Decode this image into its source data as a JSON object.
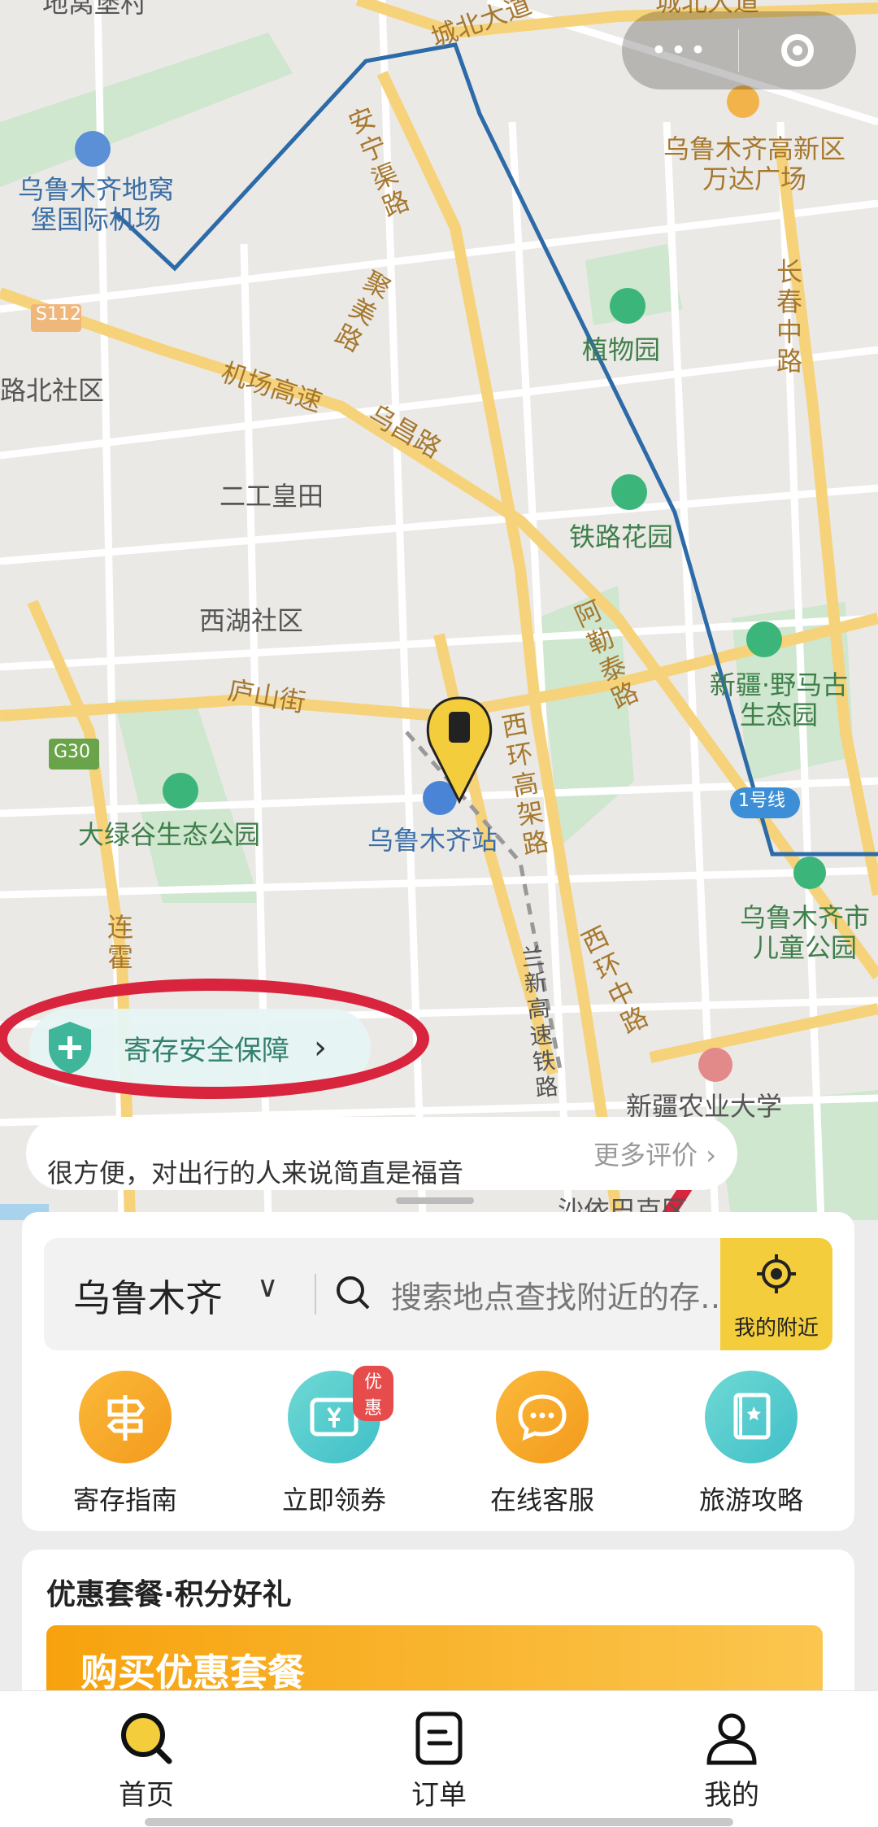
{
  "capsule": {
    "menu_glyph": "•••",
    "close_label": "◎"
  },
  "map": {
    "labels": {
      "village": "地窝堡村",
      "chengbei1": "城北大道",
      "chengbei2": "城北大道",
      "airport": "乌鲁木齐地窝堡国际机场",
      "wanda": "乌鲁木齐高新区万达广场",
      "anningqu": "安宁渠路",
      "juhua": "聚美路",
      "changchun": "长春中路",
      "s112": "S112",
      "zhiwuyuan": "植物园",
      "lubei": "路北社区",
      "jichang": "机场高速",
      "wuchang": "乌昌路",
      "ergong": "二工皇田",
      "tielu": "铁路花园",
      "xihu": "西湖社区",
      "aletai": "阿勒泰路",
      "xinjiang_ye": "新疆·野马古生态园",
      "lushan": "庐山街",
      "xihuan": "西环高架路",
      "g30": "G30",
      "line1": "1号线",
      "dalvgu": "大绿谷生态公园",
      "station": "乌鲁木齐站",
      "ertong": "乌鲁木齐市儿童公园",
      "lianhuo": "连霍",
      "lanxin": "兰新高速铁路",
      "xihuanzhong": "西环中路",
      "nongda": "新疆农业大学",
      "shayi": "沙依巴克区"
    }
  },
  "safety": {
    "label": "寄存安全保障",
    "chevron": "›"
  },
  "review": {
    "text": "很方便，对出行的人来说简直是福音",
    "more": "更多评价 ›"
  },
  "search": {
    "city": "乌鲁木齐",
    "city_chevron": "∨",
    "placeholder": "搜索地点查找附近的存…",
    "nearby": "我的附近"
  },
  "actions": [
    {
      "label": "寄存指南",
      "icon": "signpost-icon"
    },
    {
      "label": "立即领券",
      "icon": "coupon-icon",
      "badge": "优惠"
    },
    {
      "label": "在线客服",
      "icon": "chat-icon"
    },
    {
      "label": "旅游攻略",
      "icon": "guidebook-icon"
    }
  ],
  "promo": {
    "heading": "优惠套餐·积分好礼",
    "banner": "购买优惠套餐"
  },
  "tabs": [
    {
      "label": "首页",
      "icon": "home-search-icon"
    },
    {
      "label": "订单",
      "icon": "order-icon"
    },
    {
      "label": "我的",
      "icon": "profile-icon"
    }
  ],
  "colors": {
    "accent_yellow": "#f3cd3c",
    "orange": "#f5a020",
    "teal": "#4cc6c6",
    "annotation_red": "#d8243d"
  }
}
